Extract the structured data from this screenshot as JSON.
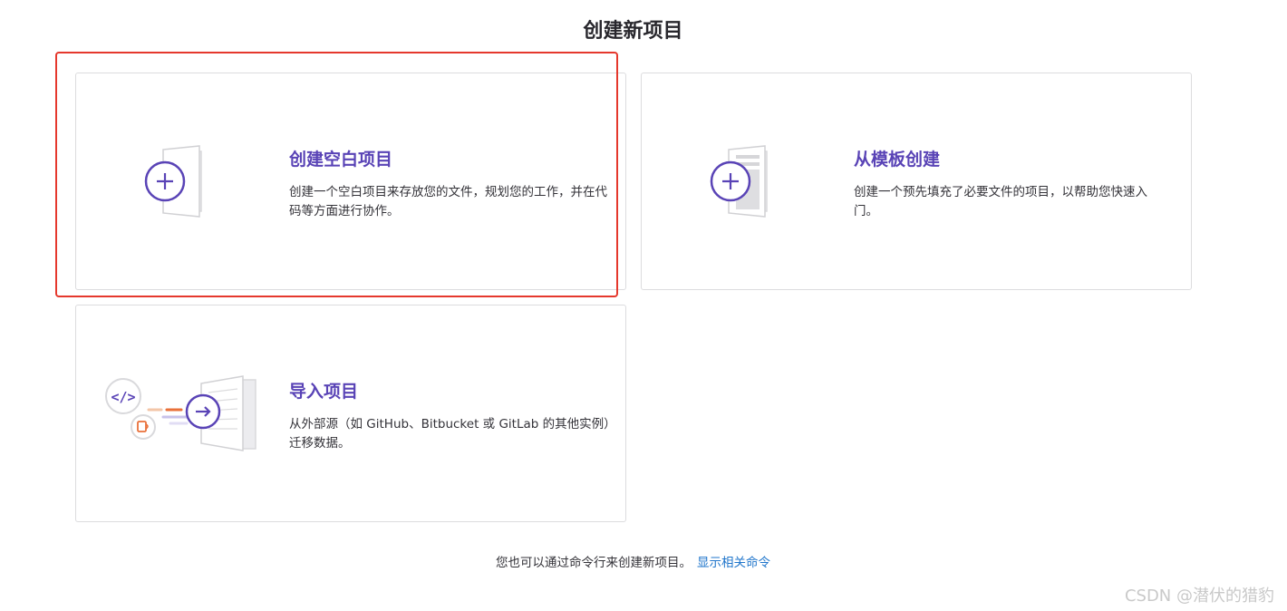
{
  "page": {
    "title": "创建新项目"
  },
  "cards": [
    {
      "id": "blank",
      "title": "创建空白项目",
      "description": "创建一个空白项目来存放您的文件，规划您的工作，并在代码等方面进行协作。",
      "icon": "blank-project-icon"
    },
    {
      "id": "template",
      "title": "从模板创建",
      "description": "创建一个预先填充了必要文件的项目，以帮助您快速入门。",
      "icon": "template-project-icon"
    },
    {
      "id": "import",
      "title": "导入项目",
      "description": "从外部源（如 GitHub、Bitbucket 或 GitLab 的其他实例）迁移数据。",
      "icon": "import-project-icon"
    }
  ],
  "cli": {
    "text": "您也可以通过命令行来创建新项目。",
    "link_label": "显示相关命令"
  },
  "watermark": "CSDN @潜伏的猎豹",
  "colors": {
    "accent": "#5943b6",
    "link": "#1f75cb",
    "highlight": "#e5382d",
    "orange": "#e9703a"
  }
}
